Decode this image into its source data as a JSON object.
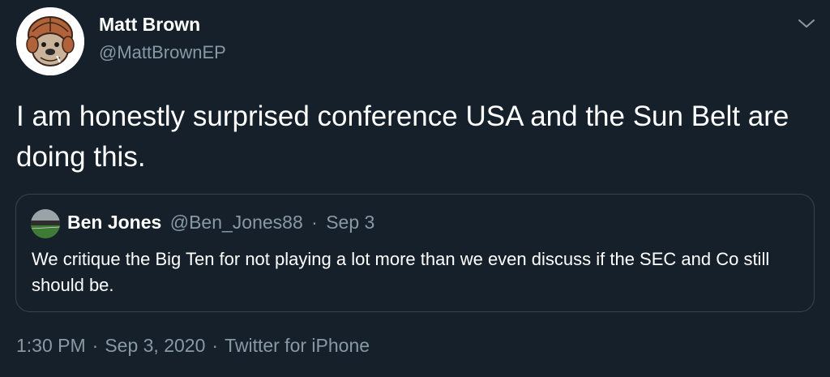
{
  "author": {
    "name": "Matt Brown",
    "handle": "@MattBrownEP",
    "avatar_icon": "bulldog-helmet-avatar"
  },
  "tweet": {
    "text": "I am honestly surprised conference USA and the Sun Belt are doing this."
  },
  "quoted_tweet": {
    "name": "Ben Jones",
    "handle": "@Ben_Jones88",
    "separator": "·",
    "date": "Sep 3",
    "text": "We critique the Big Ten for not playing a lot more than we even discuss if the SEC and Co still should be.",
    "avatar_icon": "stadium-avatar"
  },
  "footer": {
    "time": "1:30 PM",
    "date": "Sep 3, 2020",
    "source": "Twitter for iPhone",
    "separator": "·"
  },
  "menu": {
    "icon": "chevron-down-icon"
  },
  "colors": {
    "background": "#15202b",
    "text": "#ffffff",
    "secondary": "#8899a6",
    "border": "#38444d"
  }
}
